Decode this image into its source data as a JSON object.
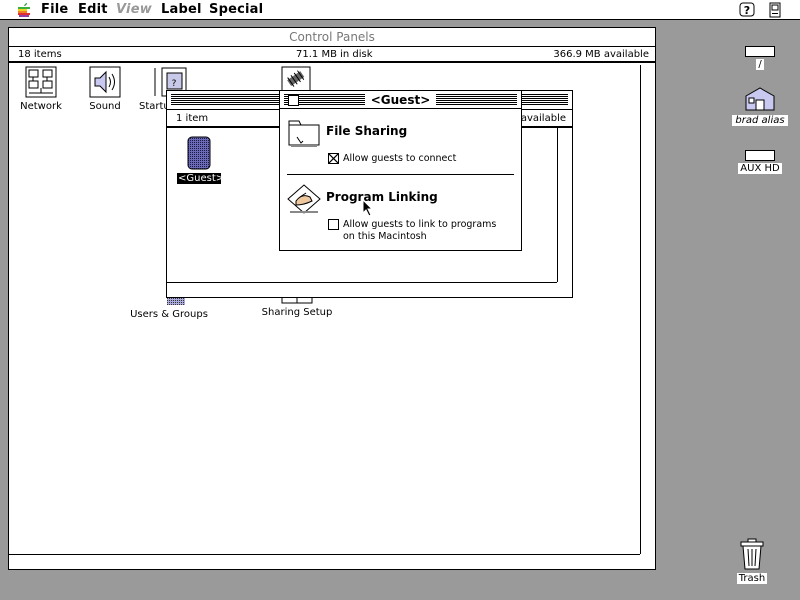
{
  "menubar": {
    "items": [
      "File",
      "Edit",
      "View",
      "Label",
      "Special"
    ]
  },
  "control_panels": {
    "title": "Control Panels",
    "count": "18 items",
    "disk": "71.1 MB in disk",
    "available": "366.9 MB available",
    "icons": {
      "network": "Network",
      "sound": "Sound",
      "startup": "Startu",
      "users": "Users & Groups",
      "sharing": "Sharing Setup"
    }
  },
  "users_window": {
    "count": "1 item",
    "available": "available",
    "guest_label": "<Guest>"
  },
  "guest_dialog": {
    "title": "<Guest>",
    "file_sharing": {
      "heading": "File Sharing",
      "checkbox_label": "Allow guests to connect",
      "checked": true
    },
    "program_linking": {
      "heading": "Program Linking",
      "checkbox_line1": "Allow guests to link to programs",
      "checkbox_line2": "on this Macintosh",
      "checked": false
    }
  },
  "desktop": {
    "disk1": "/",
    "alias": "brad alias",
    "aux": "AUX HD",
    "trash": "Trash"
  }
}
